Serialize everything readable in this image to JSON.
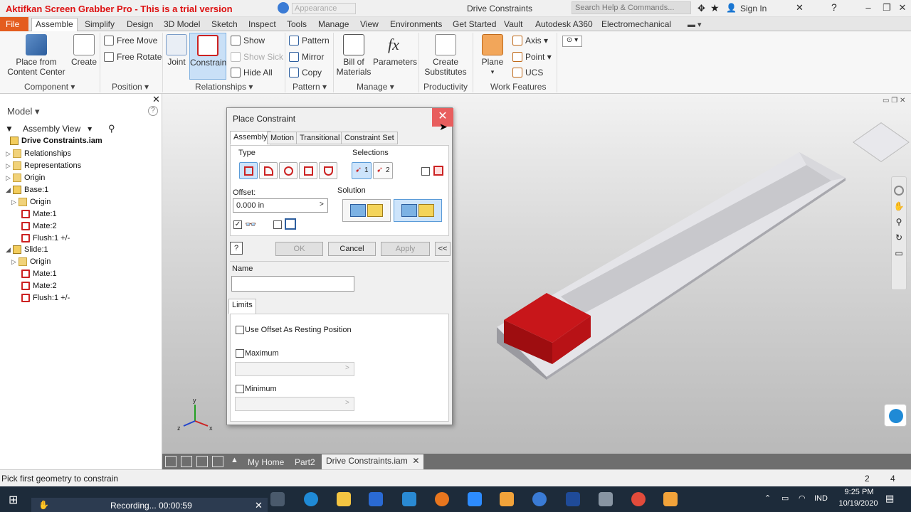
{
  "titlebar": {
    "watermark": "Aktifkan Screen Grabber Pro - This is a trial version",
    "appearance": "Appearance",
    "title": "Drive Constraints",
    "search_placeholder": "Search Help & Commands...",
    "signin": "Sign In"
  },
  "menu": {
    "file": "File",
    "tabs": [
      "Assemble",
      "Simplify",
      "Design",
      "3D Model",
      "Sketch",
      "Inspect",
      "Tools",
      "Manage",
      "View",
      "Environments",
      "Get Started",
      "Vault",
      "Autodesk A360",
      "Electromechanical"
    ]
  },
  "ribbon": {
    "place_line1": "Place from",
    "place_line2": "Content Center",
    "create": "Create",
    "free_move": "Free Move",
    "free_rotate": "Free Rotate",
    "joint": "Joint",
    "constrain": "Constrain",
    "show": "Show",
    "show_sick": "Show Sick",
    "hide_all": "Hide All",
    "pattern": "Pattern",
    "mirror": "Mirror",
    "copy": "Copy",
    "bom_line1": "Bill of",
    "bom_line2": "Materials",
    "parameters": "Parameters",
    "substitutes_line1": "Create",
    "substitutes_line2": "Substitutes",
    "plane": "Plane",
    "axis": "Axis",
    "point": "Point",
    "ucs": "UCS",
    "groups": {
      "component": "Component",
      "position": "Position",
      "relationships": "Relationships",
      "pattern": "Pattern",
      "manage": "Manage",
      "productivity": "Productivity",
      "work_features": "Work Features"
    }
  },
  "browser": {
    "title": "Model",
    "view": "Assembly View",
    "items": [
      {
        "label": "Drive Constraints.iam"
      },
      {
        "label": "Relationships"
      },
      {
        "label": "Representations"
      },
      {
        "label": "Origin"
      },
      {
        "label": "Base:1"
      },
      {
        "label": "Origin"
      },
      {
        "label": "Mate:1"
      },
      {
        "label": "Mate:2"
      },
      {
        "label": "Flush:1 +/-"
      },
      {
        "label": "Slide:1"
      },
      {
        "label": "Origin"
      },
      {
        "label": "Mate:1"
      },
      {
        "label": "Mate:2"
      },
      {
        "label": "Flush:1 +/-"
      }
    ]
  },
  "dialog": {
    "title": "Place Constraint",
    "tabs": [
      "Assembly",
      "Motion",
      "Transitional",
      "Constraint Set"
    ],
    "type_label": "Type",
    "selections_label": "Selections",
    "sel1": "1",
    "sel2": "2",
    "offset_label": "Offset:",
    "offset_value": "0.000 in",
    "solution_label": "Solution",
    "ok": "OK",
    "cancel": "Cancel",
    "apply": "Apply",
    "more": "<<",
    "name_label": "Name",
    "name_value": "",
    "limits_tab": "Limits",
    "use_offset": "Use Offset As Resting Position",
    "maximum": "Maximum",
    "minimum": "Minimum"
  },
  "doctabs": {
    "tabs": [
      "My Home",
      "Part2",
      "Drive Constraints.iam"
    ]
  },
  "status": {
    "message": "Pick first geometry to constrain",
    "count1": "2",
    "count2": "4"
  },
  "taskbar": {
    "recording": "Recording... 00:00:59",
    "lang": "IND",
    "time": "9:25 PM",
    "date": "10/19/2020"
  },
  "colors": {
    "accent": "#e45c1e",
    "selected": "#cde4fb",
    "slider_red": "#c8161a"
  }
}
